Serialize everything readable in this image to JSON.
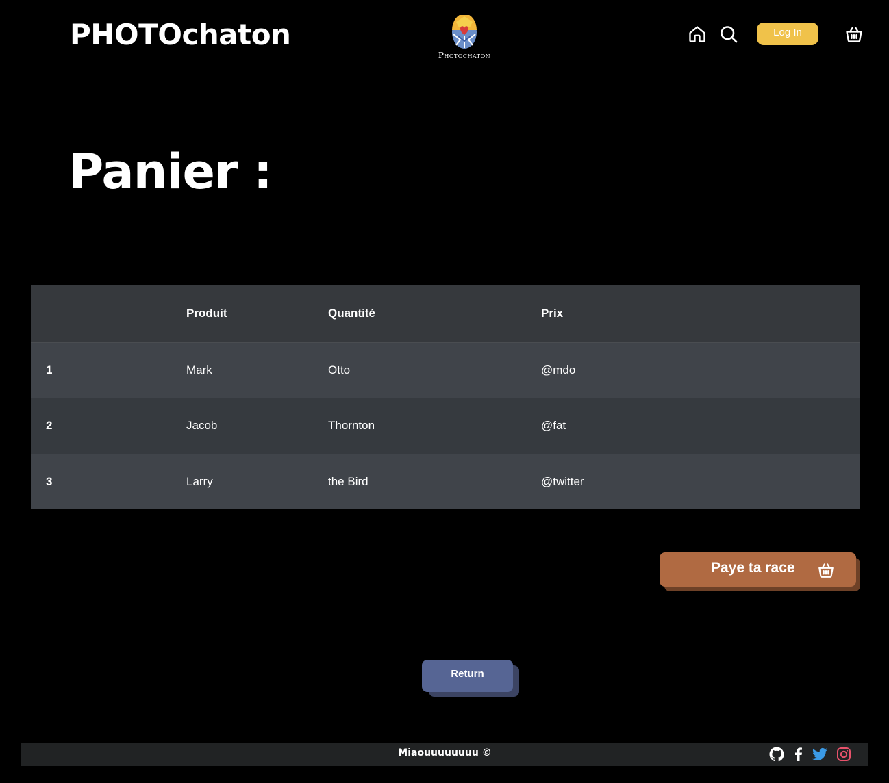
{
  "header": {
    "brand": "PHOTOchaton",
    "logo_text": "Photochaton",
    "login_label": "Log In",
    "icons": [
      "home-icon",
      "search-icon",
      "basket-icon"
    ]
  },
  "page_title": "Panier :",
  "table": {
    "headers": [
      "",
      "Produit",
      "Quantité",
      "Prix"
    ],
    "rows": [
      [
        "1",
        "Mark",
        "Otto",
        "@mdo"
      ],
      [
        "2",
        "Jacob",
        "Thornton",
        "@fat"
      ],
      [
        "3",
        "Larry",
        "the Bird",
        "@twitter"
      ]
    ]
  },
  "pay_button": {
    "label": "Paye ta race",
    "icon": "basket-icon"
  },
  "return_button": {
    "label": "Return"
  },
  "footer": {
    "text": "Miaouuuuuuuu ©",
    "social": [
      "github-icon",
      "facebook-icon",
      "twitter-icon",
      "instagram-icon"
    ]
  },
  "colors": {
    "login_button": "#f0c24a",
    "pay_button": "#b06a42",
    "return_button": "#566594",
    "twitter": "#3b9ae6",
    "instagram": "#e8526b"
  }
}
